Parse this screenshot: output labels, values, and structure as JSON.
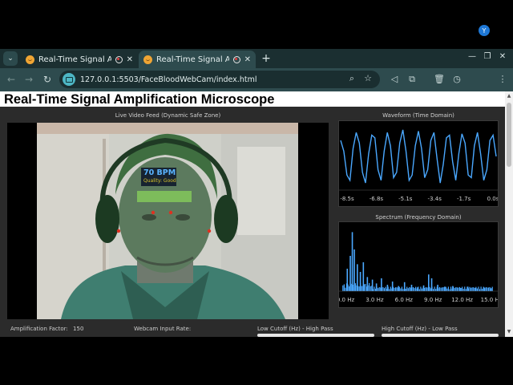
{
  "browser": {
    "tabs": [
      {
        "title": "Real-Time Signal Amp",
        "active": false
      },
      {
        "title": "Real-Time Signal Amp",
        "active": true
      }
    ],
    "url": "127.0.0.1:5503/FaceBloodWebCam/index.html",
    "profile_initial": "Y"
  },
  "page": {
    "title": "Real-Time Signal Amplification Microscope"
  },
  "video_panel": {
    "label": "Live Video Feed (Dynamic Safe Zone)",
    "bpm": "70 BPM",
    "quality": "Quality: Good"
  },
  "waveform_panel": {
    "label": "Waveform (Time Domain)"
  },
  "spectrum_panel": {
    "label": "Spectrum (Frequency Domain)"
  },
  "controls": {
    "amplification_label": "Amplification Factor:",
    "amplification_value": "150",
    "webcam_rate_label": "Webcam Input Rate:",
    "low_cutoff_label": "Low Cutoff (Hz) - High Pass",
    "high_cutoff_label": "High Cutoff (Hz) - Low Pass"
  },
  "colors": {
    "accent": "#4aa8ff",
    "bpm": "#5ab4ff",
    "quality": "#d9c32a",
    "roi": "#82c85a",
    "landmark": "#e03020"
  },
  "chart_data": [
    {
      "type": "line",
      "title": "Waveform (Time Domain)",
      "x_tick_labels": [
        "-8.5s",
        "-6.8s",
        "-5.1s",
        "-3.4s",
        "-1.7s",
        "0.0s"
      ],
      "x": [
        -10.0,
        -9.8,
        -9.6,
        -9.4,
        -9.2,
        -9.0,
        -8.8,
        -8.6,
        -8.4,
        -8.2,
        -8.0,
        -7.8,
        -7.6,
        -7.4,
        -7.2,
        -7.0,
        -6.8,
        -6.6,
        -6.4,
        -6.2,
        -6.0,
        -5.8,
        -5.6,
        -5.4,
        -5.2,
        -5.0,
        -4.8,
        -4.6,
        -4.4,
        -4.2,
        -4.0,
        -3.8,
        -3.6,
        -3.4,
        -3.2,
        -3.0,
        -2.8,
        -2.6,
        -2.4,
        -2.2,
        -2.0,
        -1.8,
        -1.6,
        -1.4,
        -1.2,
        -1.0,
        -0.8,
        -0.6,
        -0.4,
        -0.2,
        0.0
      ],
      "y": [
        0.6,
        0.2,
        -0.7,
        -0.9,
        0.3,
        0.9,
        0.5,
        -0.6,
        -1.0,
        0.1,
        0.8,
        0.7,
        -0.5,
        -0.9,
        0.2,
        0.9,
        0.4,
        -0.8,
        -0.6,
        0.5,
        1.0,
        0.2,
        -0.9,
        -0.7,
        0.4,
        0.95,
        0.3,
        -0.8,
        -0.5,
        0.6,
        0.9,
        -0.1,
        -1.0,
        -0.3,
        0.7,
        0.8,
        -0.2,
        -0.9,
        0.1,
        0.85,
        0.5,
        -0.7,
        -0.8,
        0.4,
        0.9,
        0.1,
        -0.9,
        -0.5,
        0.6,
        0.8,
        0.0
      ]
    },
    {
      "type": "bar",
      "title": "Spectrum (Frequency Domain)",
      "x_tick_labels": [
        "0.0 Hz",
        "3.0 Hz",
        "6.0 Hz",
        "9.0 Hz",
        "12.0 Hz",
        "15.0 Hz"
      ],
      "xlim": [
        0,
        15
      ],
      "ylim": [
        0,
        1
      ],
      "peaks": [
        {
          "hz": 0.5,
          "value": 0.35
        },
        {
          "hz": 0.8,
          "value": 0.55
        },
        {
          "hz": 1.0,
          "value": 0.92
        },
        {
          "hz": 1.2,
          "value": 0.65
        },
        {
          "hz": 1.5,
          "value": 0.42
        },
        {
          "hz": 1.8,
          "value": 0.3
        },
        {
          "hz": 2.1,
          "value": 0.45
        },
        {
          "hz": 2.5,
          "value": 0.22
        },
        {
          "hz": 3.0,
          "value": 0.18
        },
        {
          "hz": 3.4,
          "value": 0.12
        },
        {
          "hz": 3.9,
          "value": 0.2
        },
        {
          "hz": 4.5,
          "value": 0.1
        },
        {
          "hz": 5.0,
          "value": 0.15
        },
        {
          "hz": 5.6,
          "value": 0.08
        },
        {
          "hz": 6.2,
          "value": 0.14
        },
        {
          "hz": 6.9,
          "value": 0.1
        },
        {
          "hz": 7.5,
          "value": 0.06
        },
        {
          "hz": 8.1,
          "value": 0.09
        },
        {
          "hz": 8.6,
          "value": 0.26
        },
        {
          "hz": 8.9,
          "value": 0.2
        },
        {
          "hz": 9.5,
          "value": 0.1
        },
        {
          "hz": 10.2,
          "value": 0.07
        },
        {
          "hz": 11.0,
          "value": 0.08
        },
        {
          "hz": 11.8,
          "value": 0.05
        },
        {
          "hz": 12.5,
          "value": 0.07
        },
        {
          "hz": 13.3,
          "value": 0.05
        },
        {
          "hz": 14.1,
          "value": 0.06
        },
        {
          "hz": 14.8,
          "value": 0.04
        }
      ]
    }
  ]
}
